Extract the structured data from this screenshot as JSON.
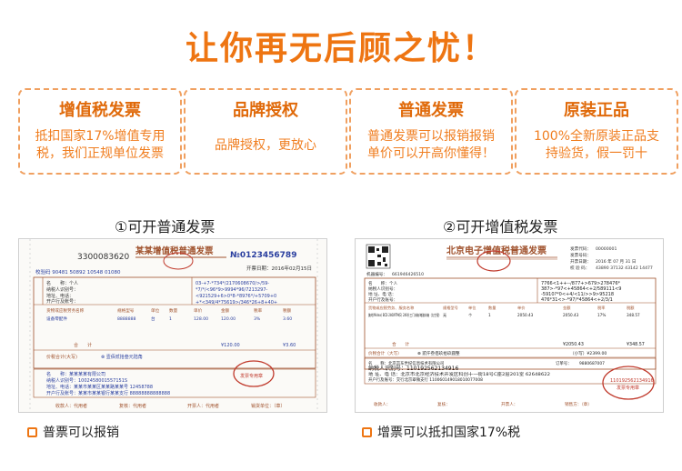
{
  "headline": "让你再无后顾之忧！",
  "cards": [
    {
      "title": "增值税发票",
      "body": "抵扣国家17%增值专用税，我们正规单位发票"
    },
    {
      "title": "品牌授权",
      "body": "品牌授权，更放心"
    },
    {
      "title": "普通发票",
      "body": "普通发票可以报销报销单价可以开高你懂得！"
    },
    {
      "title": "原装正品",
      "body": "100%全新原装正品支持验货，假一罚十"
    }
  ],
  "captions": {
    "left": "①可开普通发票",
    "right": "②可开增值税发票"
  },
  "notes": {
    "left": "普票可以报销",
    "right": "增票可以抵扣国家17%税"
  },
  "invoice_left": {
    "code": "3300083620",
    "title": "某某增值税普通发票",
    "number": "№0123456789",
    "date": "开票日期：2016年02月15日",
    "check": "校验码 90481 50892 10548 01080",
    "buyer_name": "名　　称：个人",
    "buyer_tax": "纳税人识别号：",
    "buyer_addr": "地址、电话：",
    "buyer_bank": "开户行及账号：",
    "cipher": [
      "03-+7-*734*/2170608670/>/59-",
      "*7/*/<96*9>9994*96/7213297-",
      "<921529+6>0*8-*8976*/+5709+0",
      "+*<349/4*75619>/346*26+8+40+"
    ],
    "col_headers": [
      "货物或应税劳务名称",
      "规格型号",
      "单位",
      "数量",
      "单价",
      "金额",
      "税率",
      "税额"
    ],
    "item": "设备零配件",
    "item_values": [
      "8888888",
      "台",
      "1",
      "128.00",
      "120.00",
      "3%",
      "3.60"
    ],
    "total_label": "合　　计",
    "total_amount": "¥120.00",
    "total_tax": "¥3.60",
    "total_big_label": "价税合计(大写)",
    "total_big": "⊗ 壹佰贰拾叁元陆角",
    "seller_name": "名　　称：某某某某有限公司",
    "seller_tax": "纳税人识别号：1002458001557151S",
    "seller_addr": "地址、电话：某某市某某区某某路某某号 12458788",
    "seller_bank": "开户行及账号：某某市某某银行某某支行 88888888888888",
    "stamp": "发票专用章",
    "footer": [
      "收款人：代用者",
      "复核：代用者",
      "开票人：代用者",
      "销货单位：（章）"
    ]
  },
  "invoice_right": {
    "title": "北京电子增值税普通发票",
    "code_label": "发票代码：",
    "code": "00000001",
    "num_label": "发票号码：",
    "date_label": "开票日期：",
    "date": "2016 年 07 月 31 日",
    "check_label": "校 验 码：",
    "check": "43890 37132 43142 14477",
    "machine": "机器编号：",
    "machine_no": "661946426510",
    "buyer_name": "名　　称：个人",
    "buyer_tax": "纳税人识别号：",
    "buyer_addr": "地 址、电 话：",
    "buyer_bank": "开户行及账号：",
    "cipher": [
      "7766<1++--/877+>679>278476*",
      "387>-*97<+45864<+2/589111<9",
      "-5910?*0<+4/<11/>>9>95218",
      "476*31<>-*97/*45864<+2/3/1"
    ],
    "col_headers": [
      "货物或应税劳务、服务名称",
      "规格型号",
      "单位",
      "数量",
      "单价",
      "金额",
      "税率",
      "税额"
    ],
    "item": "美的(Midea) BCD-246WTM(E) 246升三门冰箱/电脑冰箱（太空银）",
    "item_values": [
      "无",
      "个",
      "1",
      "2050.43",
      "2050.43",
      "17%",
      "348.57"
    ],
    "total_label": "合　　计",
    "total_amount": "¥2050.43",
    "total_tax": "¥348.57",
    "total_big_label": "价税合计（大写）",
    "total_big": "⊗ 贰仟叁佰玖拾玖圆整",
    "total_small": "（小写）¥2399.00",
    "seller_name": "名　　称：北京京东世纪信息技术有限公司",
    "seller_tax": "纳税人识别号：110192562134916",
    "seller_addr": "地 址、电 话：北京市北京经济技术开发区科创十一街18号C座2层201室 62648622",
    "seller_bank": "开户行及账号：交行北京翠微支行 110060149018010077008",
    "order_label": "订单号：",
    "order_no": "9880687007",
    "stamp_no": "110192562134916",
    "stamp": "发票专用章",
    "footer": [
      "收款人：",
      "复核：",
      "开票人：",
      "销售方：（章）"
    ]
  },
  "colors": {
    "accent": "#ee7512",
    "card_border": "#f0a060",
    "invoice_red": "#c0392b",
    "invoice_blue": "#2a3f9f",
    "invoice_brown": "#a0522d"
  }
}
